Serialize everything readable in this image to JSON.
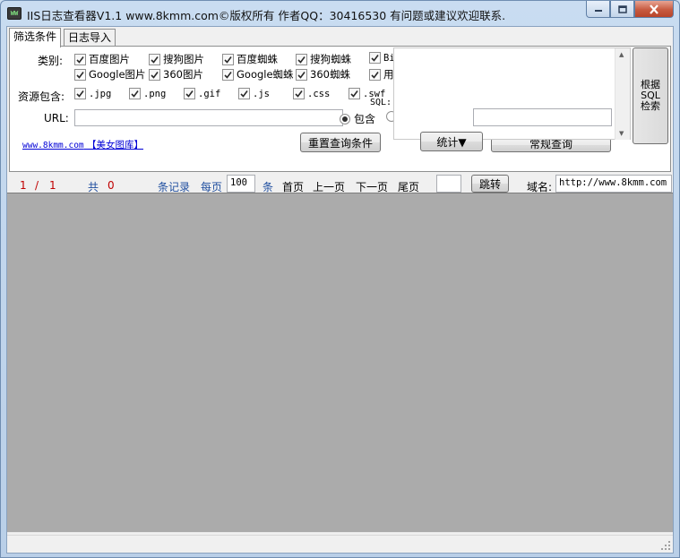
{
  "window": {
    "title": "IIS日志查看器V1.1  www.8kmm.com©版权所有  作者QQ：30416530 有问题或建议欢迎联系.",
    "icon_label": "WW"
  },
  "tabs": [
    {
      "label": "筛选条件",
      "active": true
    },
    {
      "label": "日志导入",
      "active": false
    }
  ],
  "filter": {
    "category_label": "类别:",
    "categories_row1": [
      {
        "label": "百度图片",
        "checked": true
      },
      {
        "label": "搜狗图片",
        "checked": true
      },
      {
        "label": "百度蜘蛛",
        "checked": true
      },
      {
        "label": "搜狗蜘蛛",
        "checked": true
      },
      {
        "label": "Bi",
        "checked": true
      }
    ],
    "categories_row2": [
      {
        "label": "Google图片",
        "checked": true
      },
      {
        "label": "360图片",
        "checked": true
      },
      {
        "label": "Google蜘蛛",
        "checked": true
      },
      {
        "label": "360蜘蛛",
        "checked": true
      },
      {
        "label": "用",
        "checked": true
      }
    ],
    "resource_label": "资源包含:",
    "resources": [
      {
        "label": ".jpg",
        "checked": true
      },
      {
        "label": ".png",
        "checked": true
      },
      {
        "label": ".gif",
        "checked": true
      },
      {
        "label": ".js",
        "checked": true
      },
      {
        "label": ".css",
        "checked": true
      },
      {
        "label": ".swf",
        "checked": true
      }
    ],
    "url_label": "URL:",
    "url_value": "",
    "include_radio_label": "包含",
    "link_site": "www.8kmm.com",
    "link_gallery": "【美女图库】",
    "reset_button": "重置查询条件",
    "common_query_button": "常规查询",
    "sql_label": "SQL:",
    "sql_text": "",
    "stats_button": "统计▼",
    "sql_search_button": "根据 SQL 检索"
  },
  "pager": {
    "current_page": "1",
    "separator": "/",
    "total_pages": "1",
    "total_prefix": "共",
    "total_records": "0",
    "records_label": "条记录",
    "per_page_label": "每页",
    "per_page_value": "100",
    "per_page_unit": "条",
    "first": "首页",
    "prev": "上一页",
    "next": "下一页",
    "last": "尾页",
    "jump_value": "",
    "jump_button": "跳转",
    "domain_label": "域名:",
    "domain_value": "http://www.8kmm.com"
  }
}
